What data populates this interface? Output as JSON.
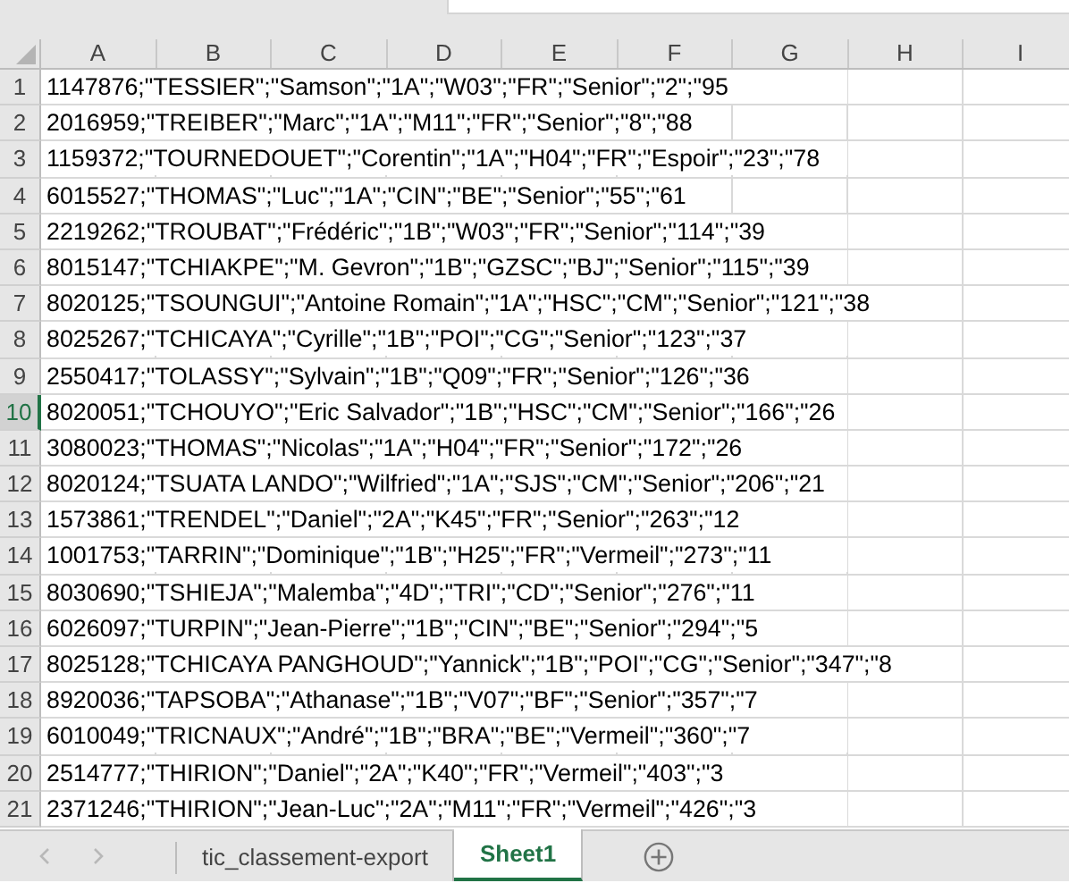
{
  "columns": [
    "A",
    "B",
    "C",
    "D",
    "E",
    "F",
    "G",
    "H",
    "I"
  ],
  "rows": [
    {
      "number": "1",
      "text": "1147876;\"TESSIER\";\"Samson\";\"1A\";\"W03\";\"FR\";\"Senior\";\"2\";\"95",
      "selected": false
    },
    {
      "number": "2",
      "text": "2016959;\"TREIBER\";\"Marc\";\"1A\";\"M11\";\"FR\";\"Senior\";\"8\";\"88",
      "selected": false
    },
    {
      "number": "3",
      "text": "1159372;\"TOURNEDOUET\";\"Corentin\";\"1A\";\"H04\";\"FR\";\"Espoir\";\"23\";\"78",
      "selected": false
    },
    {
      "number": "4",
      "text": "6015527;\"THOMAS\";\"Luc\";\"1A\";\"CIN\";\"BE\";\"Senior\";\"55\";\"61",
      "selected": false
    },
    {
      "number": "5",
      "text": "2219262;\"TROUBAT\";\"Frédéric\";\"1B\";\"W03\";\"FR\";\"Senior\";\"114\";\"39",
      "selected": false
    },
    {
      "number": "6",
      "text": "8015147;\"TCHIAKPE\";\"M. Gevron\";\"1B\";\"GZSC\";\"BJ\";\"Senior\";\"115\";\"39",
      "selected": false
    },
    {
      "number": "7",
      "text": "8020125;\"TSOUNGUI\";\"Antoine Romain\";\"1A\";\"HSC\";\"CM\";\"Senior\";\"121\";\"38",
      "selected": false
    },
    {
      "number": "8",
      "text": "8025267;\"TCHICAYA\";\"Cyrille\";\"1B\";\"POI\";\"CG\";\"Senior\";\"123\";\"37",
      "selected": false
    },
    {
      "number": "9",
      "text": "2550417;\"TOLASSY\";\"Sylvain\";\"1B\";\"Q09\";\"FR\";\"Senior\";\"126\";\"36",
      "selected": false
    },
    {
      "number": "10",
      "text": "8020051;\"TCHOUYO\";\"Eric Salvador\";\"1B\";\"HSC\";\"CM\";\"Senior\";\"166\";\"26",
      "selected": true
    },
    {
      "number": "11",
      "text": "3080023;\"THOMAS\";\"Nicolas\";\"1A\";\"H04\";\"FR\";\"Senior\";\"172\";\"26",
      "selected": false
    },
    {
      "number": "12",
      "text": "8020124;\"TSUATA LANDO\";\"Wilfried\";\"1A\";\"SJS\";\"CM\";\"Senior\";\"206\";\"21",
      "selected": false
    },
    {
      "number": "13",
      "text": "1573861;\"TRENDEL\";\"Daniel\";\"2A\";\"K45\";\"FR\";\"Senior\";\"263\";\"12",
      "selected": false
    },
    {
      "number": "14",
      "text": "1001753;\"TARRIN\";\"Dominique\";\"1B\";\"H25\";\"FR\";\"Vermeil\";\"273\";\"11",
      "selected": false
    },
    {
      "number": "15",
      "text": "8030690;\"TSHIEJA\";\"Malemba\";\"4D\";\"TRI\";\"CD\";\"Senior\";\"276\";\"11",
      "selected": false
    },
    {
      "number": "16",
      "text": "6026097;\"TURPIN\";\"Jean-Pierre\";\"1B\";\"CIN\";\"BE\";\"Senior\";\"294\";\"5",
      "selected": false
    },
    {
      "number": "17",
      "text": "8025128;\"TCHICAYA PANGHOUD\";\"Yannick\";\"1B\";\"POI\";\"CG\";\"Senior\";\"347\";\"8",
      "selected": false
    },
    {
      "number": "18",
      "text": "8920036;\"TAPSOBA\";\"Athanase\";\"1B\";\"V07\";\"BF\";\"Senior\";\"357\";\"7",
      "selected": false
    },
    {
      "number": "19",
      "text": "6010049;\"TRICNAUX\";\"André\";\"1B\";\"BRA\";\"BE\";\"Vermeil\";\"360\";\"7",
      "selected": false
    },
    {
      "number": "20",
      "text": "2514777;\"THIRION\";\"Daniel\";\"2A\";\"K40\";\"FR\";\"Vermeil\";\"403\";\"3",
      "selected": false
    },
    {
      "number": "21",
      "text": "2371246;\"THIRION\";\"Jean-Luc\";\"2A\";\"M11\";\"FR\";\"Vermeil\";\"426\";\"3",
      "selected": false
    }
  ],
  "sheet_tabs": [
    {
      "label": "tic_classement-export",
      "selected": false
    },
    {
      "label": "Sheet1",
      "selected": true
    }
  ]
}
